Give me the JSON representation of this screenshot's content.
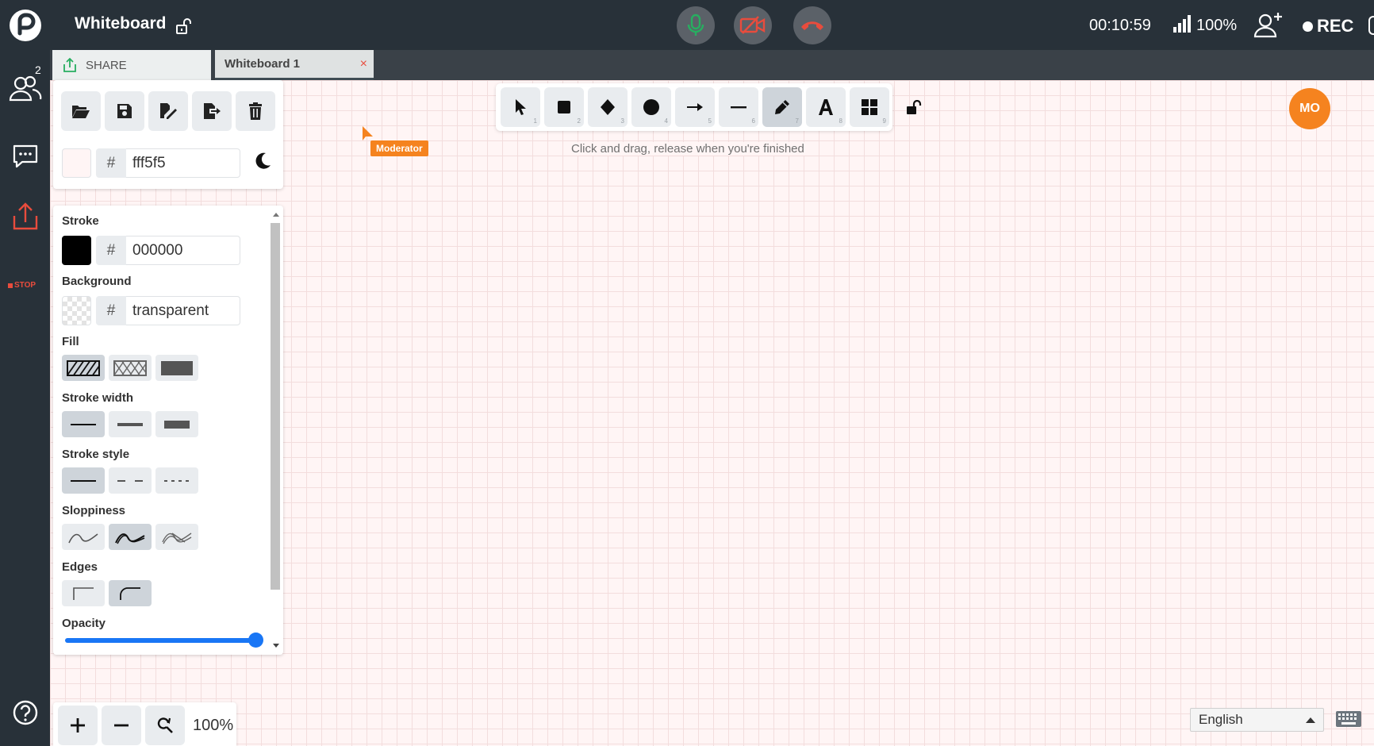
{
  "app": {
    "title": "Whiteboard"
  },
  "status": {
    "timer": "00:10:59",
    "battery": "100%",
    "rec_label": "REC"
  },
  "rail": {
    "participants_count": "2",
    "stop_label": "STOP"
  },
  "tabs": [
    {
      "label": "SHARE"
    },
    {
      "label": "Whiteboard 1",
      "close": "×"
    }
  ],
  "canvas_panel": {
    "hash": "#",
    "color_value": "fff5f5"
  },
  "props": {
    "stroke_label": "Stroke",
    "stroke_hash": "#",
    "stroke_value": "000000",
    "background_label": "Background",
    "background_hash": "#",
    "background_value": "transparent",
    "fill_label": "Fill",
    "stroke_width_label": "Stroke width",
    "stroke_style_label": "Stroke style",
    "sloppiness_label": "Sloppiness",
    "edges_label": "Edges",
    "opacity_label": "Opacity",
    "opacity_value": 1.0
  },
  "toolbar": {
    "tools": [
      {
        "icon": "pointer-icon",
        "num": "1"
      },
      {
        "icon": "rectangle-icon",
        "num": "2"
      },
      {
        "icon": "diamond-icon",
        "num": "3"
      },
      {
        "icon": "ellipse-icon",
        "num": "4"
      },
      {
        "icon": "arrow-icon",
        "num": "5"
      },
      {
        "icon": "line-icon",
        "num": "6"
      },
      {
        "icon": "pencil-icon",
        "num": "7"
      },
      {
        "icon": "text-icon",
        "num": "8"
      },
      {
        "icon": "library-icon",
        "num": "9"
      }
    ],
    "hint": "Click and drag, release when you're finished"
  },
  "cursor": {
    "label": "Moderator"
  },
  "avatar": {
    "initials": "MO"
  },
  "zoom": {
    "level": "100%"
  },
  "language": {
    "selected": "English"
  },
  "colors": {
    "accent_orange": "#f5831f",
    "danger_red": "#e84c3d",
    "mic_green": "#27ae60",
    "slider_blue": "#1976f5",
    "topbar": "#283139",
    "canvas": "#fff5f5"
  }
}
